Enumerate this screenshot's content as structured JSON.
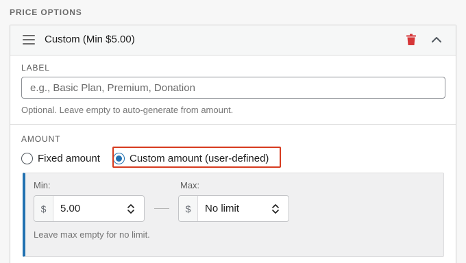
{
  "section": {
    "title": "PRICE OPTIONS"
  },
  "option": {
    "header_title": "Custom (Min $5.00)",
    "icons": {
      "drag": "drag-handle-icon",
      "delete": "trash-icon",
      "collapse": "chevron-up-icon"
    },
    "label_field": {
      "caption": "LABEL",
      "placeholder": "e.g., Basic Plan, Premium, Donation",
      "value": "",
      "help": "Optional. Leave empty to auto-generate from amount."
    },
    "amount": {
      "caption": "AMOUNT",
      "options": [
        {
          "label": "Fixed amount",
          "checked": false
        },
        {
          "label": "Custom amount (user-defined)",
          "checked": true
        }
      ],
      "min": {
        "caption": "Min:",
        "prefix": "$",
        "value": "5.00"
      },
      "max": {
        "caption": "Max:",
        "prefix": "$",
        "value": "No limit"
      },
      "help": "Leave max empty for no limit."
    }
  },
  "colors": {
    "accent": "#2271b1",
    "delete": "#d63638",
    "highlight": "#d63b1f"
  }
}
